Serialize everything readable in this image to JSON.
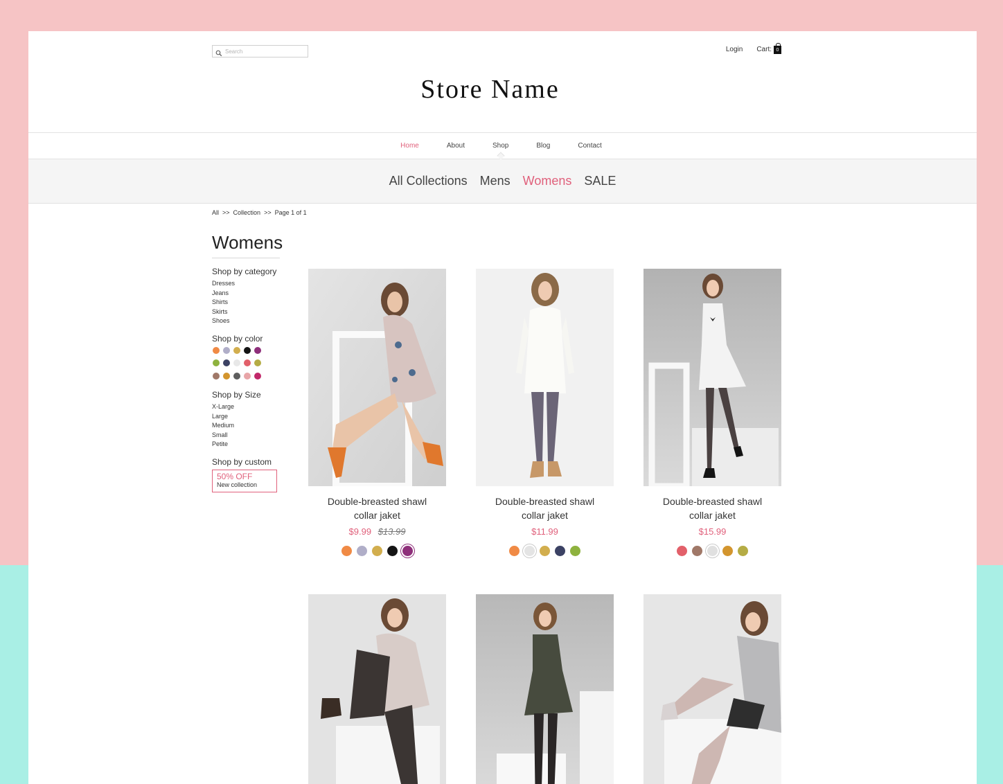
{
  "header": {
    "search_placeholder": "Search",
    "login": "Login",
    "cart_label": "Cart:",
    "cart_count": "0",
    "store_name": "Store Name"
  },
  "nav": {
    "items": [
      "Home",
      "About",
      "Shop",
      "Blog",
      "Contact"
    ],
    "active": "Home"
  },
  "subnav": {
    "items": [
      "All Collections",
      "Mens",
      "Womens",
      "SALE"
    ],
    "active": "Womens"
  },
  "breadcrumb": {
    "all": "All",
    "sep1": ">>",
    "collection": "Collection",
    "sep2": ">>",
    "page": "Page 1 of 1"
  },
  "page_title": "Womens",
  "sidebar": {
    "category_head": "Shop by category",
    "categories": [
      "Dresses",
      "Jeans",
      "Shirts",
      "Skirts",
      "Shoes"
    ],
    "color_head": "Shop by color",
    "colors": [
      "#f08a45",
      "#b0aec8",
      "#d2ae4e",
      "#141414",
      "#8e2f7a",
      "#8eb23e",
      "#3c4264",
      "#e8e8e8",
      "#e2606a",
      "#b5ac45",
      "#a07868",
      "#d3952e",
      "#5e5e5e",
      "#e8a5a8",
      "#c1286a"
    ],
    "size_head": "Shop by Size",
    "sizes": [
      "X-Large",
      "Large",
      "Medium",
      "Small",
      "Petite"
    ],
    "custom_head": "Shop by custom",
    "promo_big": "50% OFF",
    "promo_small": "New collection"
  },
  "products": [
    {
      "name_line1": "Double-breasted shawl",
      "name_line2": "collar jaket",
      "price": "$9.99",
      "old_price": "$13.99",
      "colors": [
        "#f08a45",
        "#b0aec8",
        "#d2ae4e",
        "#141414",
        "#8e2f7a"
      ],
      "selected": 4
    },
    {
      "name_line1": "Double-breasted shawl",
      "name_line2": "collar jaket",
      "price": "$11.99",
      "old_price": "",
      "colors": [
        "#f08a45",
        "#e4e4e4",
        "#d2ae4e",
        "#3c4264",
        "#8eb23e"
      ],
      "selected": 1
    },
    {
      "name_line1": "Double-breasted shawl",
      "name_line2": "collar jaket",
      "price": "$15.99",
      "old_price": "",
      "colors": [
        "#e2606a",
        "#a07868",
        "#e0e0e0",
        "#d3952e",
        "#b5ac45"
      ],
      "selected": 2
    },
    {
      "name_line1": "",
      "name_line2": "",
      "price": "",
      "old_price": "",
      "colors": [],
      "selected": -1
    },
    {
      "name_line1": "",
      "name_line2": "",
      "price": "",
      "old_price": "",
      "colors": [],
      "selected": -1
    },
    {
      "name_line1": "",
      "name_line2": "",
      "price": "",
      "old_price": "",
      "colors": [],
      "selected": -1
    }
  ],
  "accent_color": "#e0607b"
}
